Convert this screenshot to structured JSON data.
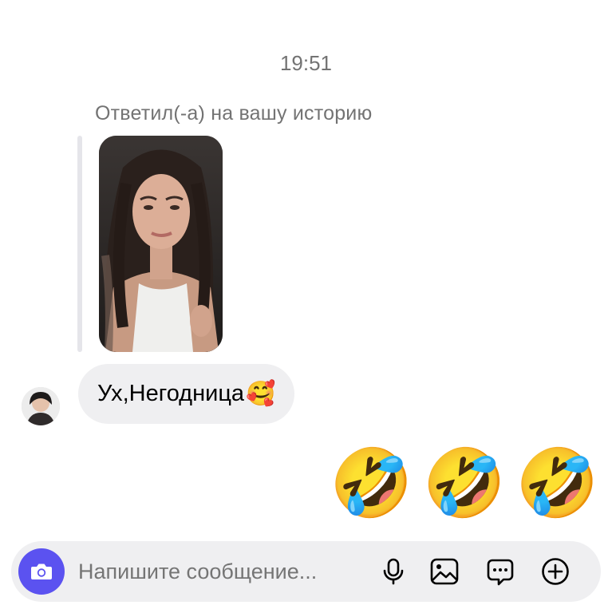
{
  "conversation": {
    "timestamp": "19:51",
    "story_reply": {
      "label": "Ответил(-а) на вашу историю"
    },
    "incoming_message": {
      "text": "Ух,Негодница",
      "emoji": "🥰"
    },
    "outgoing_message": {
      "emojis": [
        "🤣",
        "🤣",
        "🤣"
      ]
    }
  },
  "composer": {
    "placeholder": "Напишите сообщение...",
    "value": "",
    "icons": [
      "camera-icon",
      "microphone-icon",
      "gallery-icon",
      "sticker-icon",
      "plus-icon"
    ],
    "accent_color": "#5b52f0"
  }
}
